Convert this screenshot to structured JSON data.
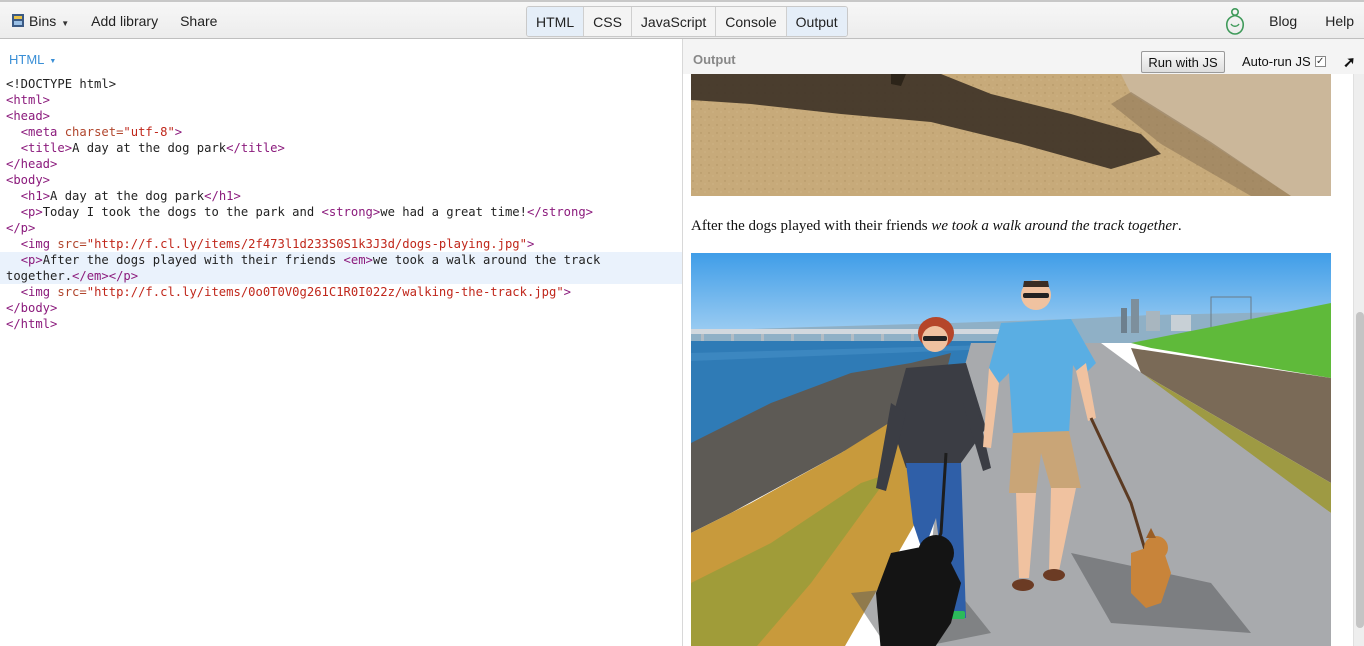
{
  "toolbar": {
    "bins_label": "Bins",
    "add_library_label": "Add library",
    "share_label": "Share",
    "panels": [
      "HTML",
      "CSS",
      "JavaScript",
      "Console",
      "Output"
    ],
    "active_panels": [
      "HTML",
      "Output"
    ],
    "blog_label": "Blog",
    "help_label": "Help"
  },
  "editor": {
    "label": "HTML",
    "highlighted_lines": [
      12,
      13
    ],
    "lines": [
      [
        [
          "txt",
          "<!DOCTYPE html>"
        ]
      ],
      [
        [
          "tag",
          "<html>"
        ]
      ],
      [
        [
          "tag",
          "<head>"
        ]
      ],
      [
        [
          "txt",
          "  "
        ],
        [
          "tag",
          "<meta "
        ],
        [
          "attr",
          "charset="
        ],
        [
          "str",
          "\"utf-8\""
        ],
        [
          "tag",
          ">"
        ]
      ],
      [
        [
          "txt",
          "  "
        ],
        [
          "tag",
          "<title>"
        ],
        [
          "txt",
          "A day at the dog park"
        ],
        [
          "tag",
          "</title>"
        ]
      ],
      [
        [
          "tag",
          "</head>"
        ]
      ],
      [
        [
          "tag",
          "<body>"
        ]
      ],
      [
        [
          "txt",
          "  "
        ],
        [
          "tag",
          "<h1>"
        ],
        [
          "txt",
          "A day at the dog park"
        ],
        [
          "tag",
          "</h1>"
        ]
      ],
      [
        [
          "txt",
          "  "
        ],
        [
          "tag",
          "<p>"
        ],
        [
          "txt",
          "Today I took the dogs to the park and "
        ],
        [
          "tag",
          "<strong>"
        ],
        [
          "txt",
          "we had a great time!"
        ],
        [
          "tag",
          "</strong>"
        ]
      ],
      [
        [
          "tag",
          "</p>"
        ]
      ],
      [
        [
          "txt",
          "  "
        ],
        [
          "tag",
          "<img "
        ],
        [
          "attr",
          "src="
        ],
        [
          "str",
          "\"http://f.cl.ly/items/2f473l1d233S0S1k3J3d/dogs-playing.jpg\""
        ],
        [
          "tag",
          ">"
        ]
      ],
      [
        [
          "txt",
          "  "
        ],
        [
          "tag",
          "<p>"
        ],
        [
          "txt",
          "After the dogs played with their friends "
        ],
        [
          "tag",
          "<em>"
        ],
        [
          "txt",
          "we took a walk around the track"
        ]
      ],
      [
        [
          "txt",
          "together."
        ],
        [
          "tag",
          "</em></p>"
        ]
      ],
      [
        [
          "txt",
          "  "
        ],
        [
          "tag",
          "<img "
        ],
        [
          "attr",
          "src="
        ],
        [
          "str",
          "\"http://f.cl.ly/items/0o0T0V0g261C1R0I022z/walking-the-track.jpg\""
        ],
        [
          "tag",
          ">"
        ]
      ],
      [
        [
          "tag",
          "</body>"
        ]
      ],
      [
        [
          "tag",
          "</html>"
        ]
      ]
    ]
  },
  "output": {
    "label": "Output",
    "run_button_label": "Run with JS",
    "autorun_label": "Auto-run JS",
    "autorun_checked": true,
    "paragraph_text": "After the dogs played with their friends ",
    "paragraph_em": "we took a walk around the track together",
    "paragraph_end": ".",
    "scroll_position": 0.55
  },
  "icons": {
    "bins": "bins-icon",
    "logo": "jsbin-logo-icon",
    "popout": "popout-arrow-icon",
    "checkbox": "checkmark-icon"
  },
  "colors": {
    "link_blue": "#3a8fd6",
    "active_panel": "#e5eef8",
    "tag": "#8b1a7c",
    "attribute": "#b0452c",
    "string": "#c0271b"
  }
}
